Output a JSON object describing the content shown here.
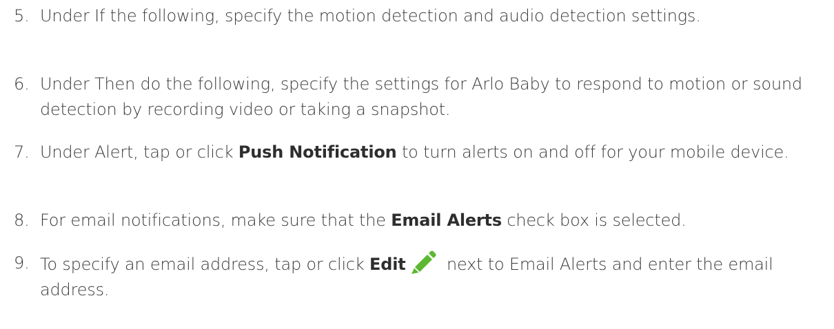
{
  "steps": [
    {
      "number": "5.",
      "text": "Under If the following, specify the motion detection and audio detection settings."
    },
    {
      "number": "6.",
      "text": "Under Then do the following, specify the settings for Arlo Baby to respond to motion or sound detection by recording video or taking a snapshot."
    },
    {
      "number": "7.",
      "before": "Under Alert, tap or click ",
      "bold": "Push Notification",
      "after": " to turn alerts on and off for your mobile device."
    },
    {
      "number": "8.",
      "before": "For email notifications,  make sure that the ",
      "bold": "Email Alerts",
      "after": " check box is selected."
    },
    {
      "number": "9.",
      "before": "To specify an email address, tap or click ",
      "bold": "Edit",
      "after": " next to Email Alerts and enter the email address.",
      "icon": "pencil-icon"
    }
  ],
  "colors": {
    "text": "#3a3a3a",
    "icon_green": "#5cb832"
  }
}
